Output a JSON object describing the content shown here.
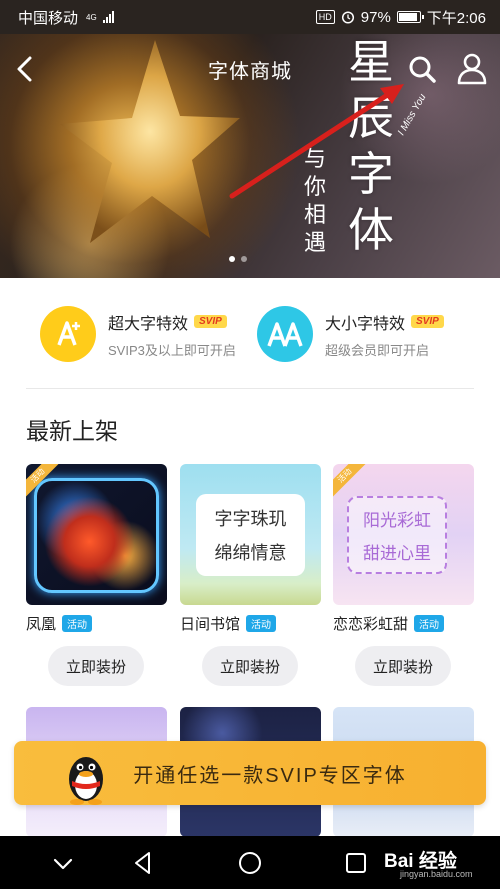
{
  "status_bar": {
    "carrier": "中国移动",
    "network": "4G",
    "hd": "HD",
    "battery": "97%",
    "time": "下午2:06"
  },
  "header": {
    "title": "字体商城",
    "back_icon": "chevron-left-icon",
    "search_icon": "search-icon",
    "user_icon": "user-icon"
  },
  "banner": {
    "deco_title": "星辰字体",
    "deco_sub": "与你相遇",
    "deco_en": "I Miss You",
    "active_dot": 1,
    "dot_count": 2
  },
  "features": [
    {
      "name": "超大字特效",
      "badge": "SVIP",
      "sub": "SVIP3及以上即可开启",
      "icon": "A+",
      "color": "#ffcc1a"
    },
    {
      "name": "大小字特效",
      "badge": "SVIP",
      "sub": "超级会员即可开启",
      "icon": "AA",
      "color": "#2ec7e6"
    }
  ],
  "section": {
    "title": "最新上架"
  },
  "fonts": [
    {
      "name": "凤凰",
      "tag": "活动",
      "button": "立即装扮",
      "ribbon": "活动"
    },
    {
      "name": "日间书馆",
      "tag": "活动",
      "button": "立即装扮",
      "preview_line1": "字字珠玑",
      "preview_line2": "绵绵情意"
    },
    {
      "name": "恋恋彩虹甜",
      "tag": "活动",
      "button": "立即装扮",
      "ribbon": "活动",
      "preview_line1": "阳光彩虹",
      "preview_line2": "甜进心里"
    }
  ],
  "promo": {
    "text": "开通任选一款SVIP专区字体"
  },
  "watermark": {
    "brand": "Bai 经验",
    "url": "jingyan.baidu.com"
  }
}
